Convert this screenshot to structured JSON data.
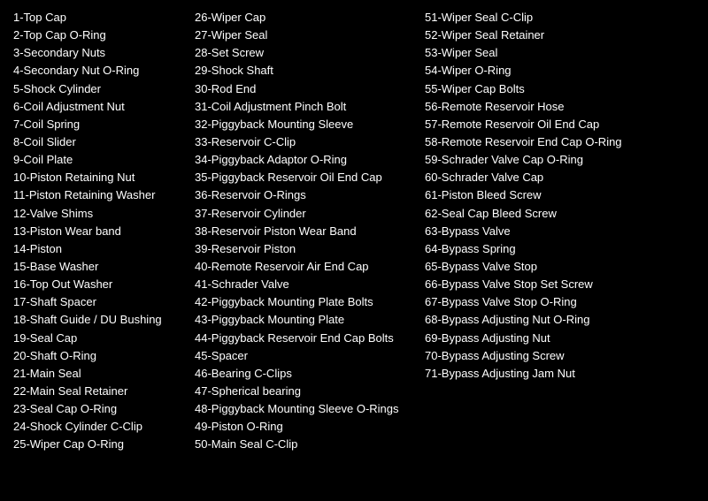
{
  "col1": [
    "1-Top Cap",
    "2-Top Cap O-Ring",
    "3-Secondary Nuts",
    "4-Secondary Nut O-Ring",
    "5-Shock Cylinder",
    "6-Coil Adjustment Nut",
    "7-Coil Spring",
    "8-Coil Slider",
    "9-Coil Plate",
    "10-Piston Retaining Nut",
    "11-Piston Retaining Washer",
    "12-Valve Shims",
    "13-Piston Wear band",
    "14-Piston",
    "15-Base Washer",
    "16-Top Out Washer",
    "17-Shaft Spacer",
    "18-Shaft Guide / DU Bushing",
    "19-Seal Cap",
    "20-Shaft O-Ring",
    "21-Main Seal",
    "22-Main Seal Retainer",
    "23-Seal Cap O-Ring",
    "24-Shock Cylinder C-Clip",
    "25-Wiper Cap O-Ring"
  ],
  "col2": [
    "26-Wiper Cap",
    "27-Wiper Seal",
    "28-Set Screw",
    "29-Shock Shaft",
    "30-Rod End",
    "31-Coil Adjustment Pinch Bolt",
    "32-Piggyback Mounting Sleeve",
    "33-Reservoir C-Clip",
    "34-Piggyback Adaptor O-Ring",
    "35-Piggyback Reservoir Oil End Cap",
    "36-Reservoir O-Rings",
    "37-Reservoir Cylinder",
    "38-Reservoir Piston Wear Band",
    "39-Reservoir Piston",
    "40-Remote Reservoir Air End Cap",
    "41-Schrader Valve",
    "42-Piggyback Mounting Plate Bolts",
    "43-Piggyback Mounting Plate",
    "44-Piggyback Reservoir End Cap Bolts",
    "45-Spacer",
    "46-Bearing C-Clips",
    "47-Spherical bearing",
    "48-Piggyback Mounting Sleeve O-Rings",
    "49-Piston O-Ring",
    "50-Main Seal C-Clip"
  ],
  "col3": [
    "51-Wiper Seal C-Clip",
    "52-Wiper Seal Retainer",
    "53-Wiper Seal",
    "54-Wiper O-Ring",
    "55-Wiper Cap Bolts",
    "56-Remote Reservoir Hose",
    "57-Remote Reservoir Oil End Cap",
    "58-Remote Reservoir End Cap O-Ring",
    "59-Schrader Valve Cap O-Ring",
    "60-Schrader Valve Cap",
    "61-Piston Bleed Screw",
    "62-Seal Cap Bleed Screw",
    "63-Bypass Valve",
    "64-Bypass Spring",
    "65-Bypass Valve Stop",
    "66-Bypass Valve Stop Set Screw",
    "67-Bypass Valve Stop O-Ring",
    "68-Bypass Adjusting Nut O-Ring",
    "69-Bypass Adjusting Nut",
    "70-Bypass Adjusting Screw",
    "71-Bypass Adjusting Jam Nut"
  ]
}
